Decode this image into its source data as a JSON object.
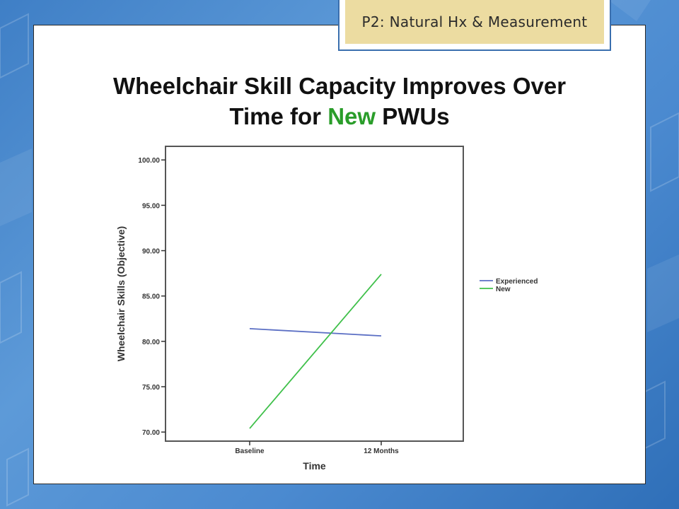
{
  "slide": {
    "tag": "P2: Natural Hx & Measurement",
    "title_line1": "Wheelchair Skill Capacity Improves Over",
    "title_line2_prefix": "Time for ",
    "title_line2_highlight": "New",
    "title_line2_suffix": " PWUs",
    "colors": {
      "highlight": "#2a9d2a",
      "tag_background": "#ecdca1",
      "background_blue": "#4b8ad0"
    }
  },
  "chart_data": {
    "type": "line",
    "xlabel": "Time",
    "ylabel": "Wheelchair Skills (Objective)",
    "categories": [
      "Baseline",
      "12 Months"
    ],
    "ylim": [
      69,
      101.5
    ],
    "yticks": [
      70,
      75,
      80,
      85,
      90,
      95,
      100
    ],
    "ytick_labels": [
      "70.00",
      "75.00",
      "80.00",
      "85.00",
      "90.00",
      "95.00",
      "100.00"
    ],
    "grid": false,
    "legend_position": "right",
    "series": [
      {
        "name": "Experienced",
        "values": [
          81.4,
          80.6
        ],
        "color": "#5b6fc4"
      },
      {
        "name": "New",
        "values": [
          70.4,
          87.4
        ],
        "color": "#3fc04a"
      }
    ]
  }
}
